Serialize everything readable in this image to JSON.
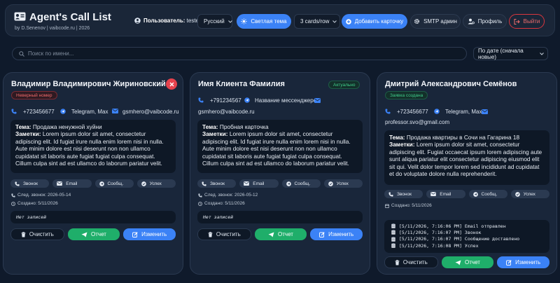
{
  "header": {
    "title": "Agent's Call List",
    "subtitle": "by D.Senenov | vaibcode.ru | 2026",
    "user_label": "Пользователь:",
    "user_name": "tester",
    "language": "Русский",
    "theme_button": "Светлая тема",
    "cards_per_row": "3 cards/row",
    "add_card_button": "Добавить карточку",
    "smtp_button": "SMTP админ",
    "profile_button": "Профиль",
    "logout_button": "Выйти"
  },
  "search": {
    "placeholder": "Поиск по имени..."
  },
  "sort": {
    "value": "По дате (сначала новые)"
  },
  "labels": {
    "topic": "Тема:",
    "notes": "Заметки:",
    "call": "Звонок",
    "email": "Email",
    "message": "Сообщ.",
    "success": "Успех",
    "clear": "Очистить",
    "report": "Отчет",
    "edit": "Изменить"
  },
  "cards": [
    {
      "name": "Владимир Владимирович Жириновский",
      "badge": "Неверный номер",
      "phone": "+723456677",
      "messenger": "Telegram, Max",
      "email": "gsmhero@vaibcode.ru",
      "topic": "Продажа ненужной хуйни",
      "notes": "Lorem ipsum dolor sit amet, consectetur adipiscing elit. Id fugiat irure nulla enim lorem nisi in nulla. Aute minim dolore est nisi deserunt non non ullamco cupidatat sit laboris aute fugiat fugiat culpa consequat. Cillum culpa sint ad est ullamco do laborum pariatur velit.",
      "next_call": "След. звонок: 2026-05-14",
      "created": "Создано: 5/11/2026",
      "log_empty": "Нет записей"
    },
    {
      "name": "Имя Клиента Фамилия",
      "badge": "Актуально",
      "phone": "+791234567",
      "messenger": "Название мессенджеров",
      "email": "gsmhero@vaibcode.ru",
      "topic": "Пробная карточка",
      "notes": "Lorem ipsum dolor sit amet, consectetur adipiscing elit. Id fugiat irure nulla enim lorem nisi in nulla. Aute minim dolore est nisi deserunt non non ullamco cupidatat sit laboris aute fugiat fugiat culpa consequat. Cillum culpa sint ad est ullamco do laborum pariatur velit.",
      "next_call": "След. звонок: 2026-05-12",
      "created": "Создано: 5/11/2026",
      "log_empty": "Нет записей"
    },
    {
      "name": "Дмитрий Александрович Семёнов",
      "badge": "Заявка создана",
      "phone": "+723456677",
      "messenger": "Telegram, Max",
      "email": "professor.svo@gmail.com",
      "topic": "Продажа квартиры в Сочи на Гагарина 18",
      "notes": "Lorem ipsum dolor sit amet, consectetur adipiscing elit. Fugiat occaecat ipsum lorem adipiscing aute sunt aliqua pariatur elit consectetur adipiscing eiusmod elit sit qui. Velit dolor tempor lorem sed incididunt ad cupidatat et do voluptate dolore nulla reprehenderit.",
      "created": "Создано: 5/11/2026",
      "log": [
        "[5/11/2026, 7:16:06 PM] Email отправлен",
        "[5/11/2026, 7:16:07 PM] Звонок",
        "[5/11/2026, 7:16:07 PM] Сообщение доставлено",
        "[5/11/2026, 7:16:08 PM] Успех"
      ]
    }
  ],
  "colors": {
    "background": "#0f1a2b",
    "card": "#19263a",
    "primary": "#3b82f6",
    "success": "#1fae6a",
    "danger": "#e5424d"
  }
}
